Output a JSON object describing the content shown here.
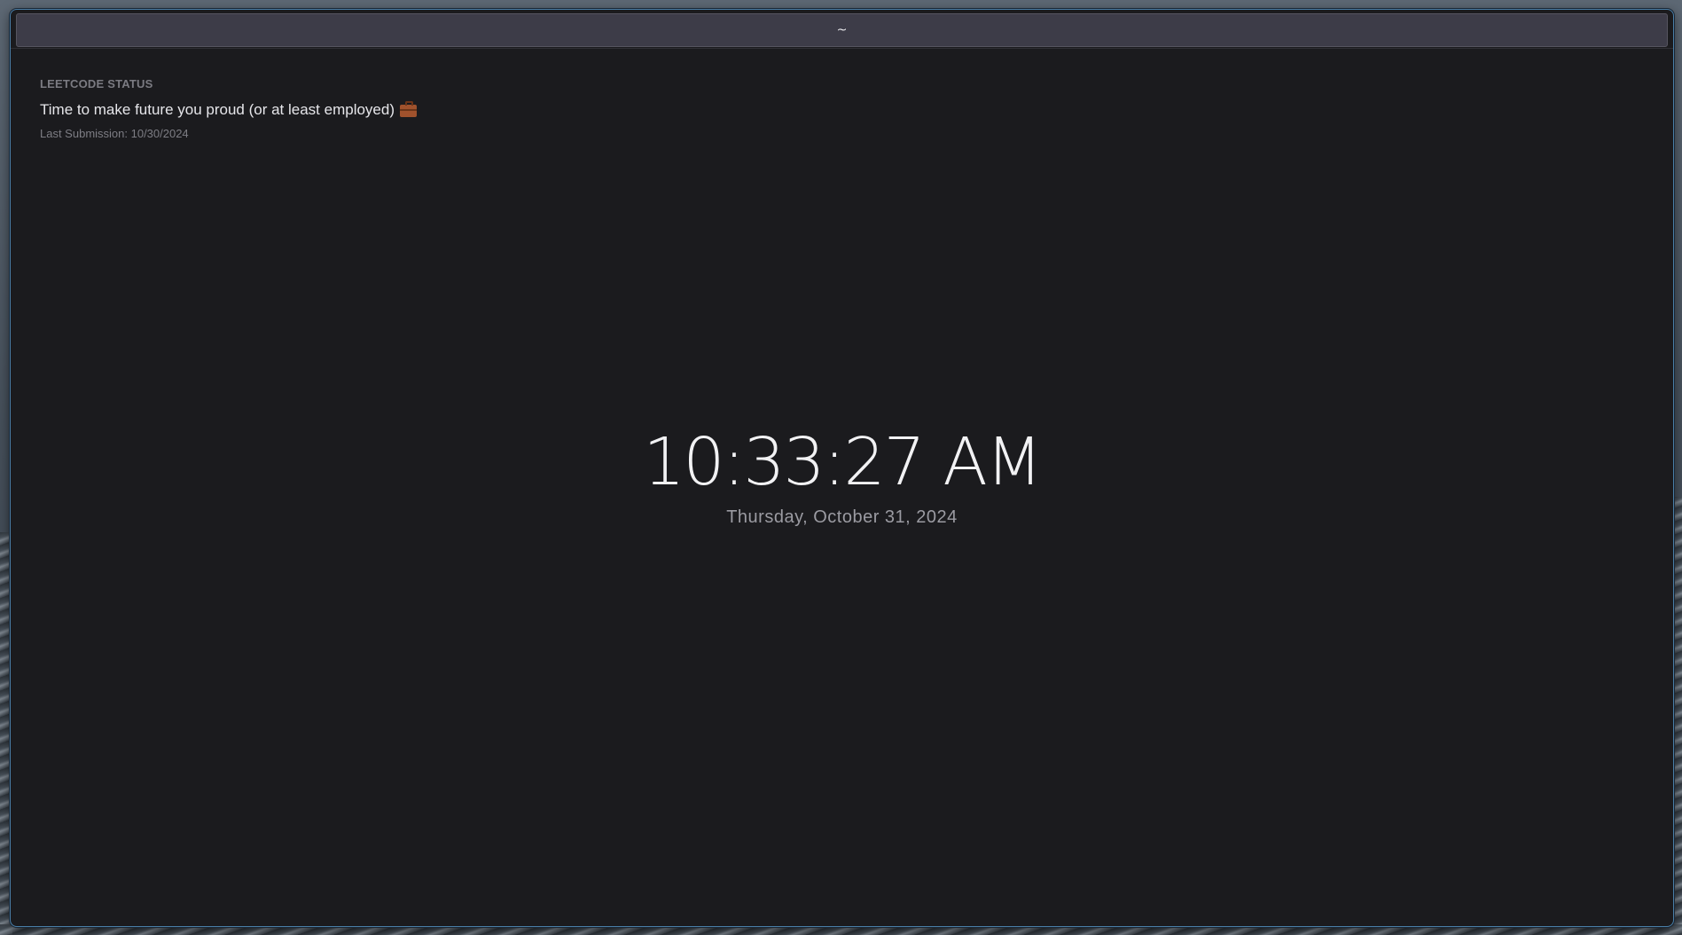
{
  "window": {
    "title": "~"
  },
  "leetcode": {
    "header": "LEETCODE STATUS",
    "message": "Time to make future you proud (or at least employed)",
    "message_icon": "briefcase-icon",
    "last_submission": "Last Submission: 10/30/2024"
  },
  "clock": {
    "time": "10:33:27 AM",
    "date": "Thursday, October 31, 2024"
  },
  "colors": {
    "background": "#1b1b1e",
    "titlebar": "#3d3c48",
    "border_accent": "#4a7fa8"
  }
}
